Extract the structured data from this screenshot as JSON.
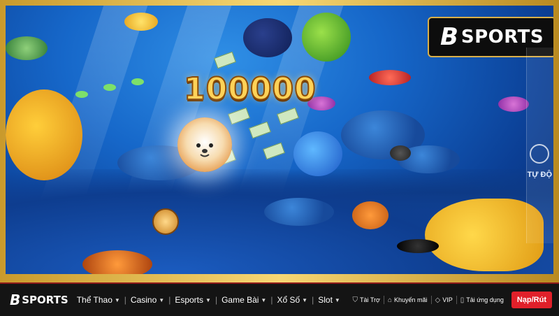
{
  "game": {
    "score": "100000",
    "side_label": "TỰ ĐỘ"
  },
  "brand": {
    "logo_mark": "B",
    "logo_text": "SPORTS"
  },
  "nav": {
    "logo_mark": "B",
    "logo_text": "SPORTS",
    "menu": [
      {
        "label": "Thể Thao"
      },
      {
        "label": "Casino"
      },
      {
        "label": "Esports"
      },
      {
        "label": "Game Bài"
      },
      {
        "label": "Xổ Số"
      },
      {
        "label": "Slot"
      }
    ],
    "links": [
      {
        "label": "Tài Trợ",
        "icon": "shield-icon"
      },
      {
        "label": "Khuyến mãi",
        "icon": "tag-icon"
      },
      {
        "label": "VIP",
        "icon": "diamond-icon"
      },
      {
        "label": "Tải ứng dụng",
        "icon": "phone-icon"
      }
    ],
    "cta_label": "Nạp/Rút"
  },
  "colors": {
    "accent_red": "#e0202a",
    "gold": "#ffd257",
    "ocean": "#1667c9"
  }
}
